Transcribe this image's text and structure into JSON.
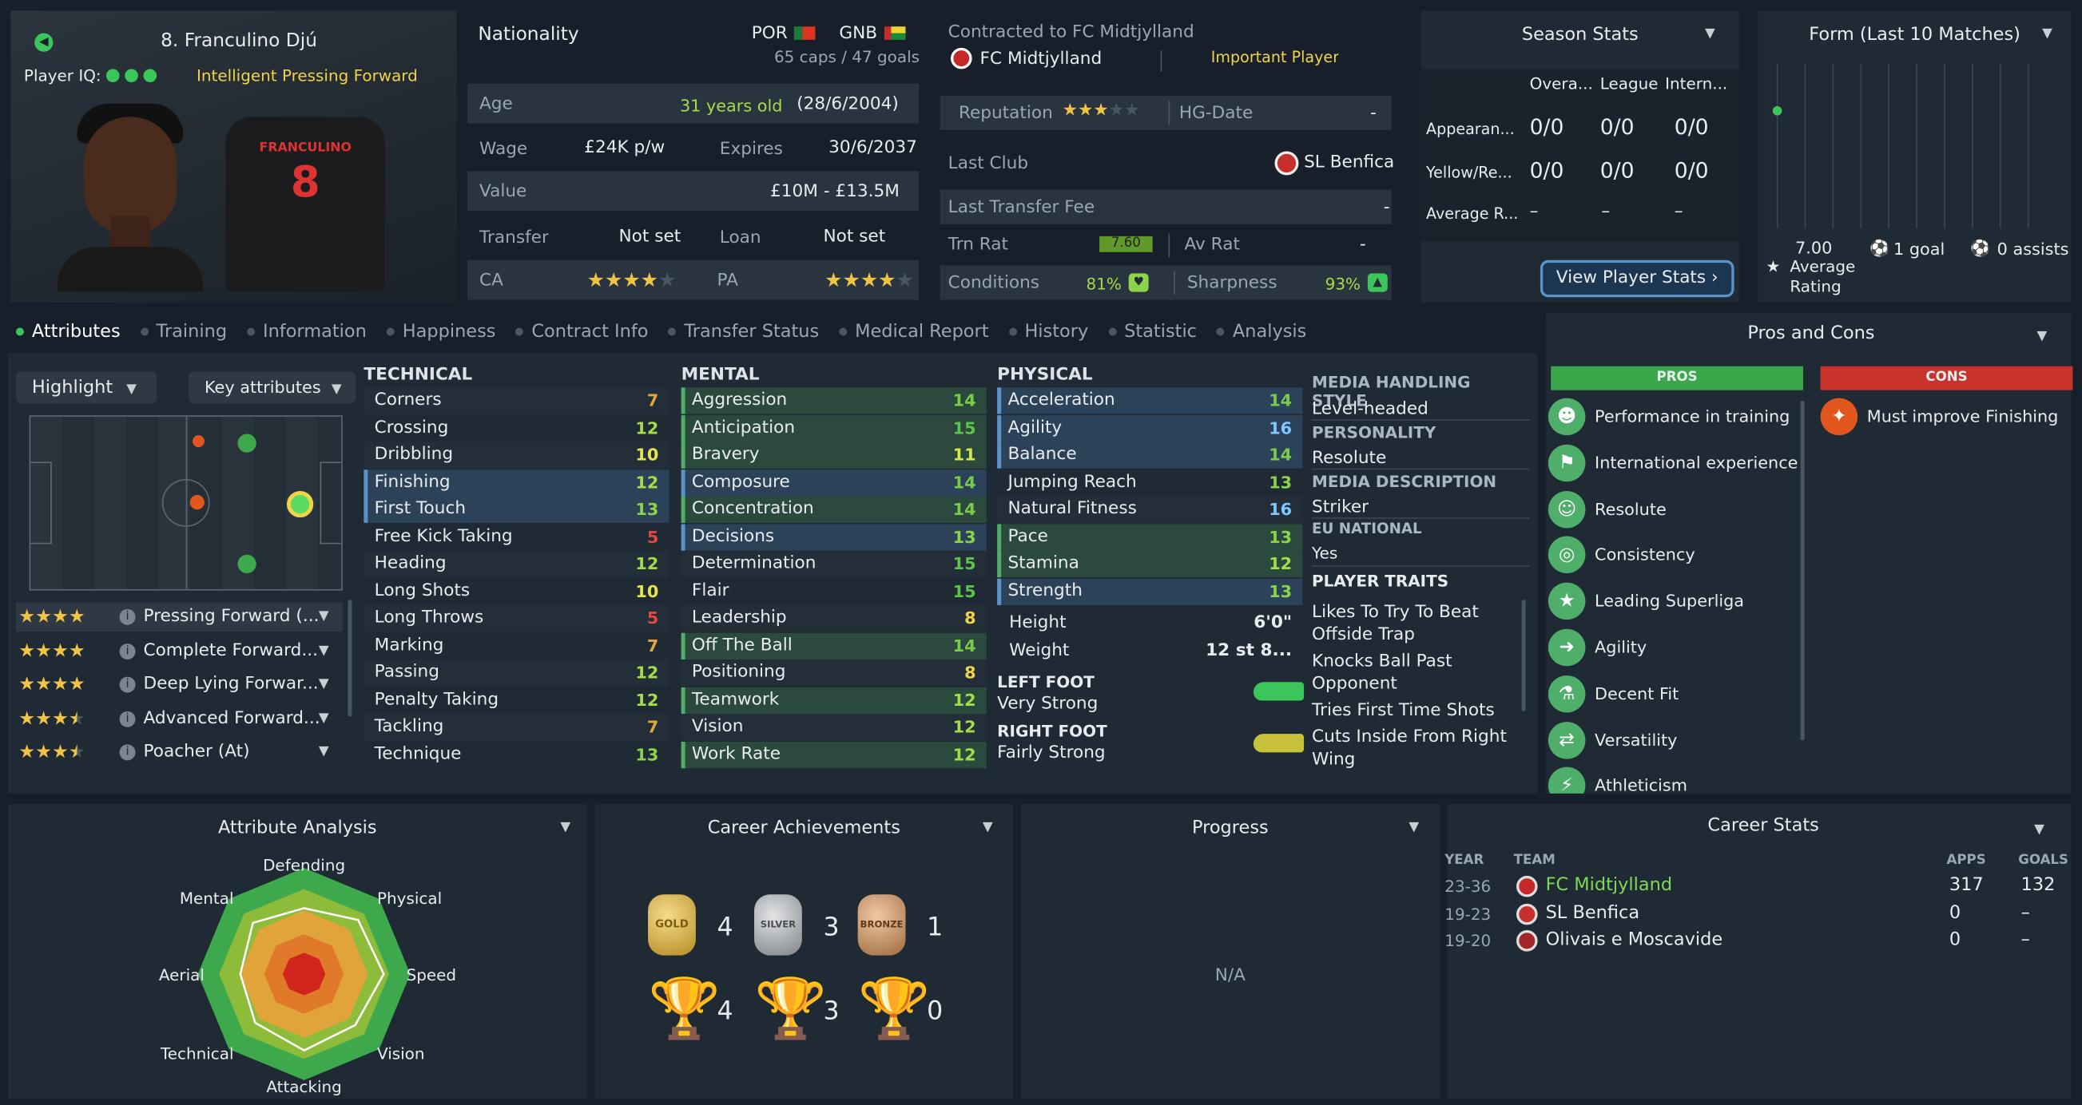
{
  "player": {
    "header": "8. Franculino Djú",
    "iq_label": "Player IQ:",
    "role_desc": "Intelligent Pressing Forward",
    "shirt_name": "FRANCULINO",
    "shirt_number": "8"
  },
  "details": {
    "nationality_label": "Nationality",
    "nat1": "POR",
    "nat2": "GNB",
    "caps": "65 caps / 47 goals",
    "age_label": "Age",
    "age_value": "31 years old",
    "dob": "(28/6/2004)",
    "wage_label": "Wage",
    "wage_value": "£24K p/w",
    "expires_label": "Expires",
    "expires_value": "30/6/2037",
    "value_label": "Value",
    "value_value": "£10M - £13.5M",
    "transfer_label": "Transfer",
    "transfer_value": "Not set",
    "loan_label": "Loan",
    "loan_value": "Not set",
    "ca_label": "CA",
    "pa_label": "PA",
    "ca_stars": 4,
    "pa_stars": 4
  },
  "contract": {
    "contracted": "Contracted to FC Midtjylland",
    "club": "FC Midtjylland",
    "status": "Important Player",
    "reputation_label": "Reputation",
    "reputation_stars": 3,
    "hg_label": "HG-Date",
    "hg_value": "-",
    "last_club_label": "Last Club",
    "last_club_value": "SL Benfica",
    "last_fee_label": "Last Transfer Fee",
    "last_fee_value": "-",
    "trn_label": "Trn Rat",
    "trn_value": "7.60",
    "av_label": "Av Rat",
    "av_value": "-",
    "conditions_label": "Conditions",
    "conditions_value": "81%",
    "sharpness_label": "Sharpness",
    "sharpness_value": "93%"
  },
  "season": {
    "title": "Season Stats",
    "cols": [
      "Overa...",
      "League",
      "Intern..."
    ],
    "rows": [
      {
        "label": "Appearan...",
        "v": [
          "0/0",
          "0/0",
          "0/0"
        ]
      },
      {
        "label": "Yellow/Re...",
        "v": [
          "0/0",
          "0/0",
          "0/0"
        ]
      },
      {
        "label": "Average R...",
        "v": [
          "–",
          "–",
          "–"
        ]
      }
    ],
    "button": "View Player Stats"
  },
  "form": {
    "title": "Form (Last 10 Matches)",
    "rating": "7.00",
    "rating_label": "Average Rating",
    "goals": "1 goal",
    "assists": "0 assists"
  },
  "tabs": [
    "Attributes",
    "Training",
    "Information",
    "Happiness",
    "Contract Info",
    "Transfer Status",
    "Medical Report",
    "History",
    "Statistic",
    "Analysis"
  ],
  "controls": {
    "highlight": "Highlight",
    "key_attr": "Key attributes"
  },
  "roles": [
    {
      "name": "Pressing Forward (...",
      "stars": 4
    },
    {
      "name": "Complete Forward...",
      "stars": 4
    },
    {
      "name": "Deep Lying Forwar...",
      "stars": 4
    },
    {
      "name": "Advanced Forward...",
      "stars": 3.5
    },
    {
      "name": "Poacher (At)",
      "stars": 3.5
    }
  ],
  "technical": {
    "title": "TECHNICAL",
    "items": [
      {
        "n": "Corners",
        "v": 7,
        "hl": ""
      },
      {
        "n": "Crossing",
        "v": 12,
        "hl": ""
      },
      {
        "n": "Dribbling",
        "v": 10,
        "hl": ""
      },
      {
        "n": "Finishing",
        "v": 12,
        "hl": "blue"
      },
      {
        "n": "First Touch",
        "v": 13,
        "hl": "blue"
      },
      {
        "n": "Free Kick Taking",
        "v": 5,
        "hl": ""
      },
      {
        "n": "Heading",
        "v": 12,
        "hl": ""
      },
      {
        "n": "Long Shots",
        "v": 10,
        "hl": ""
      },
      {
        "n": "Long Throws",
        "v": 5,
        "hl": ""
      },
      {
        "n": "Marking",
        "v": 7,
        "hl": ""
      },
      {
        "n": "Passing",
        "v": 12,
        "hl": ""
      },
      {
        "n": "Penalty Taking",
        "v": 12,
        "hl": ""
      },
      {
        "n": "Tackling",
        "v": 7,
        "hl": ""
      },
      {
        "n": "Technique",
        "v": 13,
        "hl": ""
      }
    ]
  },
  "mental": {
    "title": "MENTAL",
    "items": [
      {
        "n": "Aggression",
        "v": 14,
        "hl": "green"
      },
      {
        "n": "Anticipation",
        "v": 15,
        "hl": "green"
      },
      {
        "n": "Bravery",
        "v": 11,
        "hl": "green"
      },
      {
        "n": "Composure",
        "v": 14,
        "hl": "blue"
      },
      {
        "n": "Concentration",
        "v": 14,
        "hl": "green"
      },
      {
        "n": "Decisions",
        "v": 13,
        "hl": "blue"
      },
      {
        "n": "Determination",
        "v": 15,
        "hl": ""
      },
      {
        "n": "Flair",
        "v": 15,
        "hl": ""
      },
      {
        "n": "Leadership",
        "v": 8,
        "hl": ""
      },
      {
        "n": "Off The Ball",
        "v": 14,
        "hl": "green"
      },
      {
        "n": "Positioning",
        "v": 8,
        "hl": ""
      },
      {
        "n": "Teamwork",
        "v": 12,
        "hl": "green"
      },
      {
        "n": "Vision",
        "v": 12,
        "hl": ""
      },
      {
        "n": "Work Rate",
        "v": 12,
        "hl": "green"
      }
    ]
  },
  "physical": {
    "title": "PHYSICAL",
    "items": [
      {
        "n": "Acceleration",
        "v": 14,
        "hl": "blue"
      },
      {
        "n": "Agility",
        "v": 16,
        "hl": "blue"
      },
      {
        "n": "Balance",
        "v": 14,
        "hl": "blue"
      },
      {
        "n": "Jumping Reach",
        "v": 13,
        "hl": ""
      },
      {
        "n": "Natural Fitness",
        "v": 16,
        "hl": ""
      },
      {
        "n": "Pace",
        "v": 13,
        "hl": "green"
      },
      {
        "n": "Stamina",
        "v": 12,
        "hl": "green"
      },
      {
        "n": "Strength",
        "v": 13,
        "hl": "blue"
      }
    ],
    "height_label": "Height",
    "height_value": "6'0\"",
    "weight_label": "Weight",
    "weight_value": "12 st 8...",
    "left_foot_label": "LEFT FOOT",
    "left_foot_value": "Very Strong",
    "right_foot_label": "RIGHT FOOT",
    "right_foot_value": "Fairly Strong"
  },
  "info": {
    "media_style_label": "MEDIA HANDLING STYLE",
    "media_style_value": "Level-headed",
    "personality_label": "PERSONALITY",
    "personality_value": "Resolute",
    "media_desc_label": "MEDIA DESCRIPTION",
    "media_desc_value": "Striker",
    "eu_label": "EU NATIONAL",
    "eu_value": "Yes",
    "traits_label": "PLAYER TRAITS",
    "traits": [
      "Likes To Try To Beat Offside Trap",
      "Knocks Ball Past Opponent",
      "Tries First Time Shots",
      "Cuts Inside From Right Wing"
    ]
  },
  "pros_cons": {
    "title": "Pros and Cons",
    "pros_label": "PROS",
    "cons_label": "CONS",
    "pros": [
      "Performance in training",
      "International experience",
      "Resolute",
      "Consistency",
      "Leading Superliga",
      "Agility",
      "Decent Fit",
      "Versatility",
      "Athleticism"
    ],
    "cons": [
      "Must improve Finishing"
    ]
  },
  "analysis": {
    "title": "Attribute Analysis",
    "axes": [
      "Defending",
      "Physical",
      "Speed",
      "Vision",
      "Attacking",
      "Technical",
      "Aerial",
      "Mental"
    ]
  },
  "achievements": {
    "title": "Career Achievements",
    "medals": [
      {
        "label": "GOLD",
        "count": "4"
      },
      {
        "label": "SILVER",
        "count": "3"
      },
      {
        "label": "BRONZE",
        "count": "1"
      }
    ],
    "trophies": [
      {
        "count": "4"
      },
      {
        "count": "3"
      },
      {
        "count": "0"
      }
    ]
  },
  "progress": {
    "title": "Progress",
    "empty": "N/A"
  },
  "career": {
    "title": "Career Stats",
    "headers": [
      "YEAR",
      "TEAM",
      "APPS",
      "GOALS"
    ],
    "rows": [
      {
        "year": "23-36",
        "team": "FC Midtjylland",
        "apps": "317",
        "goals": "132"
      },
      {
        "year": "19-23",
        "team": "SL Benfica",
        "apps": "0",
        "goals": "–"
      },
      {
        "year": "19-20",
        "team": "Olivais e Moscavide",
        "apps": "0",
        "goals": "–"
      }
    ]
  },
  "colors": {
    "accent": "#3cc55a",
    "pros": "#3aa84a",
    "cons": "#c8342c",
    "highlight_blue": "#5a93c9"
  }
}
